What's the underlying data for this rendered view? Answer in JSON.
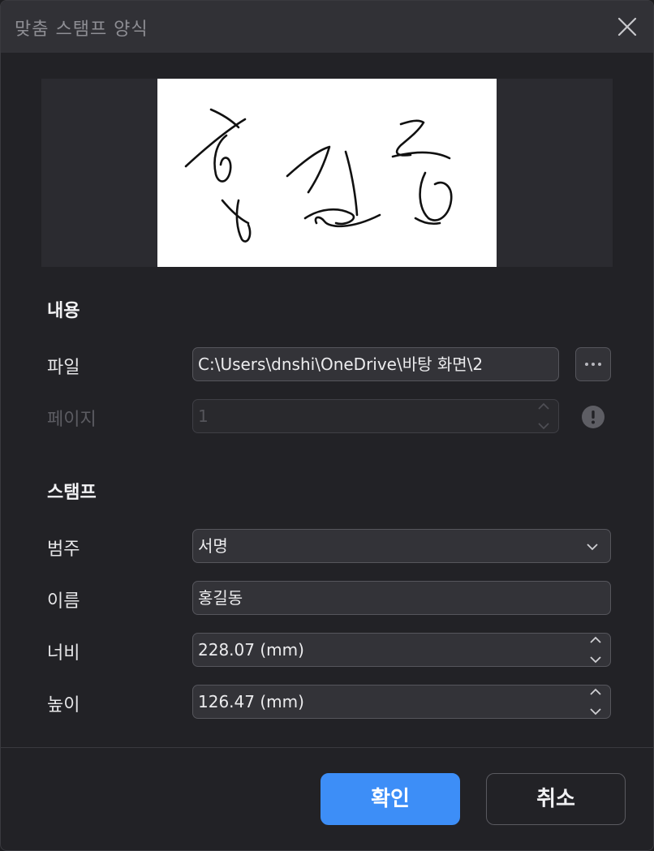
{
  "dialog": {
    "title": "맞춤 스탬프 양식",
    "close_icon": "close-icon"
  },
  "content_section": {
    "heading": "내용",
    "file_label": "파일",
    "file_value": "C:\\Users\\dnshi\\OneDrive\\바탕 화면\\2",
    "browse_icon": "more-horizontal-icon",
    "page_label": "페이지",
    "page_value": "1",
    "info_icon": "exclamation-icon"
  },
  "stamp_section": {
    "heading": "스탬프",
    "category_label": "범주",
    "category_value": "서명",
    "name_label": "이름",
    "name_value": "홍길동",
    "width_label": "너비",
    "width_value": "228.07 (mm)",
    "height_label": "높이",
    "height_value": "126.47 (mm)"
  },
  "buttons": {
    "ok": "확인",
    "cancel": "취소"
  },
  "colors": {
    "accent": "#3d8ef7",
    "background": "#222226",
    "titlebar": "#313136"
  }
}
